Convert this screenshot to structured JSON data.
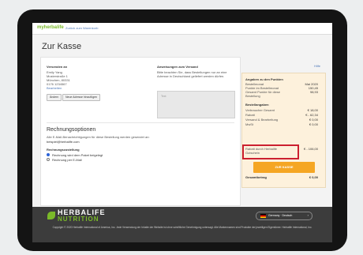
{
  "header": {
    "logo": "myherbalife",
    "back_link": "Zurück zum Warenkorb"
  },
  "page": {
    "title": "Zur Kasse",
    "help_link": "Hilfe"
  },
  "shipping_from": {
    "heading": "Versenden an",
    "lines": [
      "Emily Yang",
      "Musterstraße 1",
      "München, 80331",
      "0176 1234567"
    ],
    "edit_link": "Bearbeiten",
    "buttons": [
      "Ändern",
      "Neue Adresse hinzufügen"
    ]
  },
  "shipping_notes": {
    "heading": "Anweisungen zum Versand",
    "text": "Bitte beachten Sie, dass Bestellungen nur an eine Adresse in Deutschland geliefert werden dürfen.",
    "placeholder": "Text"
  },
  "billing": {
    "heading": "Rechnungsoptionen",
    "text": "Alle E-Mail-Benachrichtigungen für diese Bestellung werden gesendet an:",
    "email": "beispiel@herbalife.com",
    "delivery_label": "Rechnungszustellung",
    "options": [
      "Rechnung wird dem Paket beigelegt",
      "Rechnung per E-Mail"
    ]
  },
  "summary": {
    "heading": "Angaben zu den Punkten",
    "rows": [
      {
        "label": "Bestellmonat",
        "value": "Mai 2020"
      },
      {
        "label": "Punkte im Bestellmonat",
        "value": "150,45"
      },
      {
        "label": "Gesamt Punkte für diese Bestellung",
        "value": "98,93"
      }
    ],
    "order_heading": "Bestellangaben",
    "order_rows": [
      {
        "label": "Verbraucher Gesamt",
        "value": "€ 18,00"
      },
      {
        "label": "Rabatt",
        "value": "€ - 62,34"
      },
      {
        "label": "Versand & Bearbeitung",
        "value": "€ 0,00"
      },
      {
        "label": "MwSt",
        "value": "€ 0,00"
      },
      {
        "label": "Rabatt durch Herbalife Gutschein",
        "value": "€ - 106,00"
      }
    ],
    "total_label": "Gesamtbetrag",
    "total_value": "€ 0,00",
    "checkout_button": "ZUR KASSE"
  },
  "footer": {
    "brand_line1": "HERBALIFE",
    "brand_line2": "NUTRITION",
    "country": "Germany · Deutsch",
    "legal": "Copyright © 2020 Herbalife International of America, Inc. Jede Verwendung der Inhalte der Website ist ohne schriftliche Genehmigung untersagt. Alle Markennamen sind Produkte der jeweiligen Eigentümer. Herbalife International, Inc."
  },
  "colors": {
    "accent_orange": "#f5a623",
    "brand_green": "#7ab929",
    "highlight_red": "#cc2030",
    "summary_bg": "#fdf1dc"
  }
}
